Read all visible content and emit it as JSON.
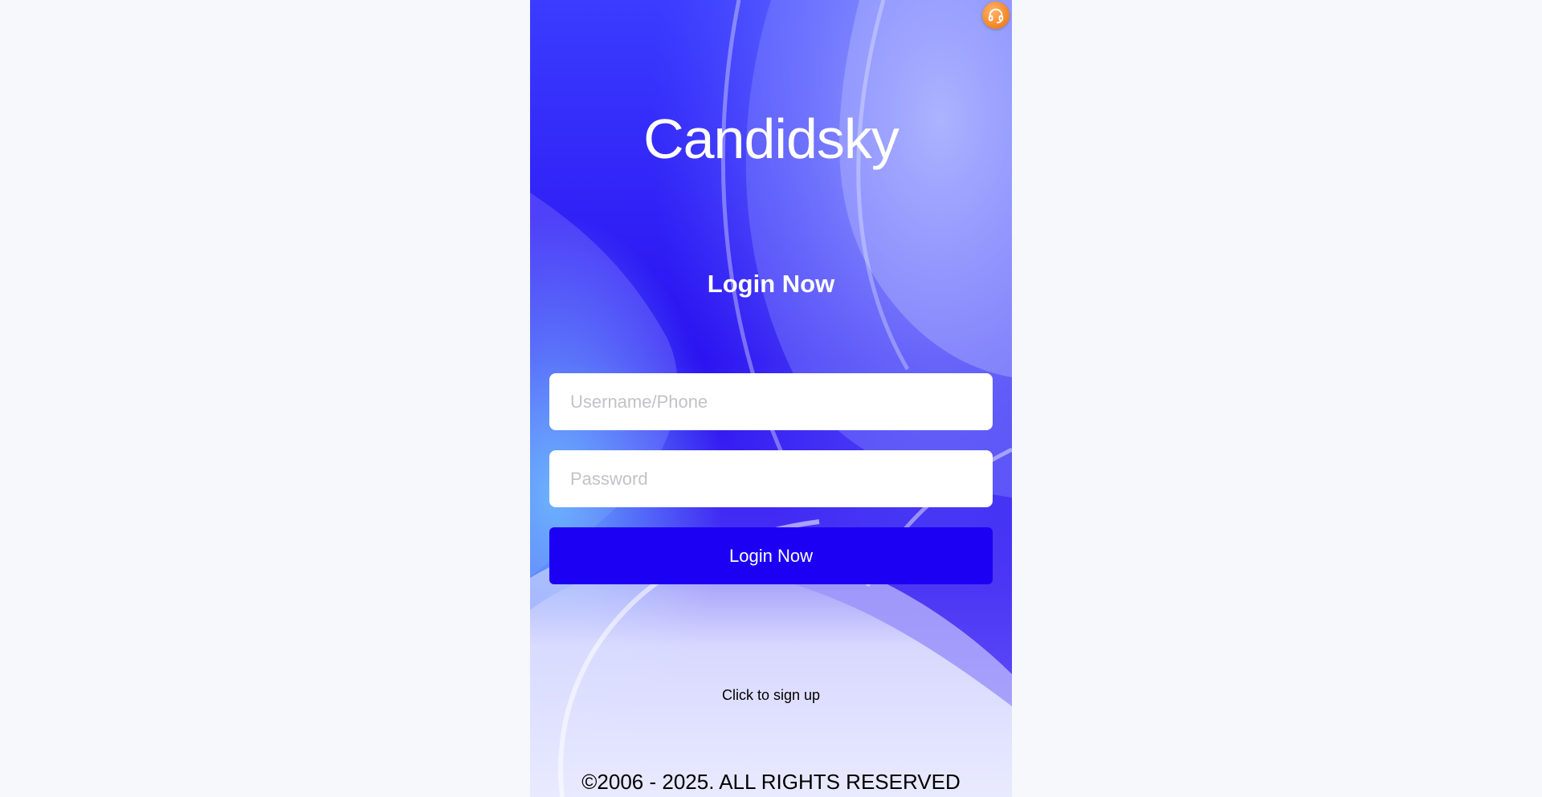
{
  "brand": {
    "logo_text": "Candidsky"
  },
  "login": {
    "heading": "Login Now",
    "username_placeholder": "Username/Phone",
    "password_placeholder": "Password",
    "submit_label": "Login Now"
  },
  "signup": {
    "link_label": "Click to sign up"
  },
  "footer": {
    "copyright": "©2006 - 2025. ALL RIGHTS RESERVED"
  },
  "support": {
    "icon": "headset-icon"
  },
  "colors": {
    "page_bg": "#f6f8fb",
    "panel_primary": "#2a10f0",
    "button_bg": "#1c00f4",
    "support_orange": "#f58a2a"
  }
}
